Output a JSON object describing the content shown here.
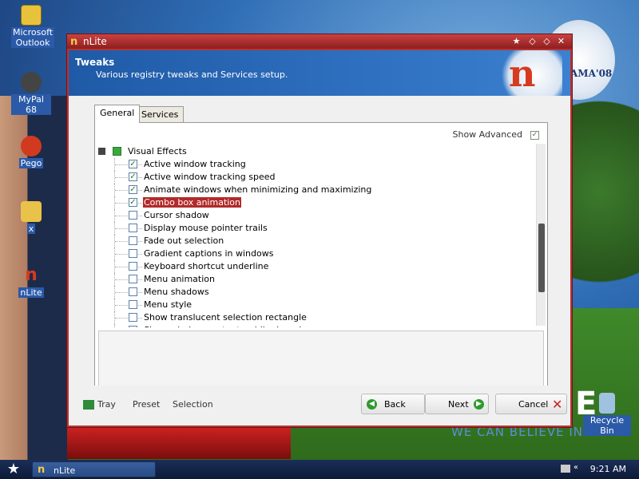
{
  "desktop": {
    "icons": [
      {
        "label": "Microsoft Outlook",
        "icon": "outlook-icon",
        "color": "#e8c23a"
      },
      {
        "label": "MyPal 68",
        "icon": "raccoon-icon",
        "color": "#444444"
      },
      {
        "label": "Pego",
        "icon": "pego-icon",
        "color": "#d23a1f"
      },
      {
        "label": "x",
        "icon": "folder-icon",
        "color": "#e9c24a"
      },
      {
        "label": "nLite",
        "icon": "nlite-icon",
        "color": "#d63a1f"
      },
      {
        "label": "Recycle Bin",
        "icon": "recycle-bin-icon",
        "color": "#9fc2e0"
      }
    ],
    "slogan": "WE CAN BELIEVE IN",
    "poster_letter": "E",
    "logo_text": "AMA'08"
  },
  "window": {
    "title": "nLite",
    "header_title": "Tweaks",
    "header_subtitle": "Various registry tweaks and Services setup.",
    "tabs": [
      {
        "label": "General",
        "active": true
      },
      {
        "label": "Services",
        "active": false
      }
    ],
    "show_advanced_label": "Show Advanced",
    "show_advanced_checked": true,
    "tree": {
      "root": "Visual Effects",
      "items": [
        {
          "label": "Active window tracking",
          "checked": true
        },
        {
          "label": "Active window tracking speed",
          "checked": true
        },
        {
          "label": "Animate windows when minimizing and maximizing",
          "checked": true
        },
        {
          "label": "Combo box animation",
          "checked": true,
          "selected": true
        },
        {
          "label": "Cursor shadow",
          "checked": false
        },
        {
          "label": "Display mouse pointer trails",
          "checked": false
        },
        {
          "label": "Fade out selection",
          "checked": false
        },
        {
          "label": "Gradient captions in windows",
          "checked": false
        },
        {
          "label": "Keyboard shortcut underline",
          "checked": false
        },
        {
          "label": "Menu animation",
          "checked": false
        },
        {
          "label": "Menu shadows",
          "checked": false
        },
        {
          "label": "Menu style",
          "checked": false
        },
        {
          "label": "Show translucent selection rectangle",
          "checked": false
        },
        {
          "label": "Show window contents while dragging",
          "checked": false
        }
      ]
    },
    "footer": {
      "tray_label": "Tray",
      "preset_label": "Preset",
      "selection_label": "Selection",
      "back_label": "Back",
      "next_label": "Next",
      "cancel_label": "Cancel"
    }
  },
  "taskbar": {
    "task_label": "nLite",
    "clock": "9:21 AM"
  },
  "colors": {
    "window_frame": "#b83434",
    "header": "#1f5aa6",
    "selection": "#b22a2a",
    "check": "#1f7a1f"
  }
}
